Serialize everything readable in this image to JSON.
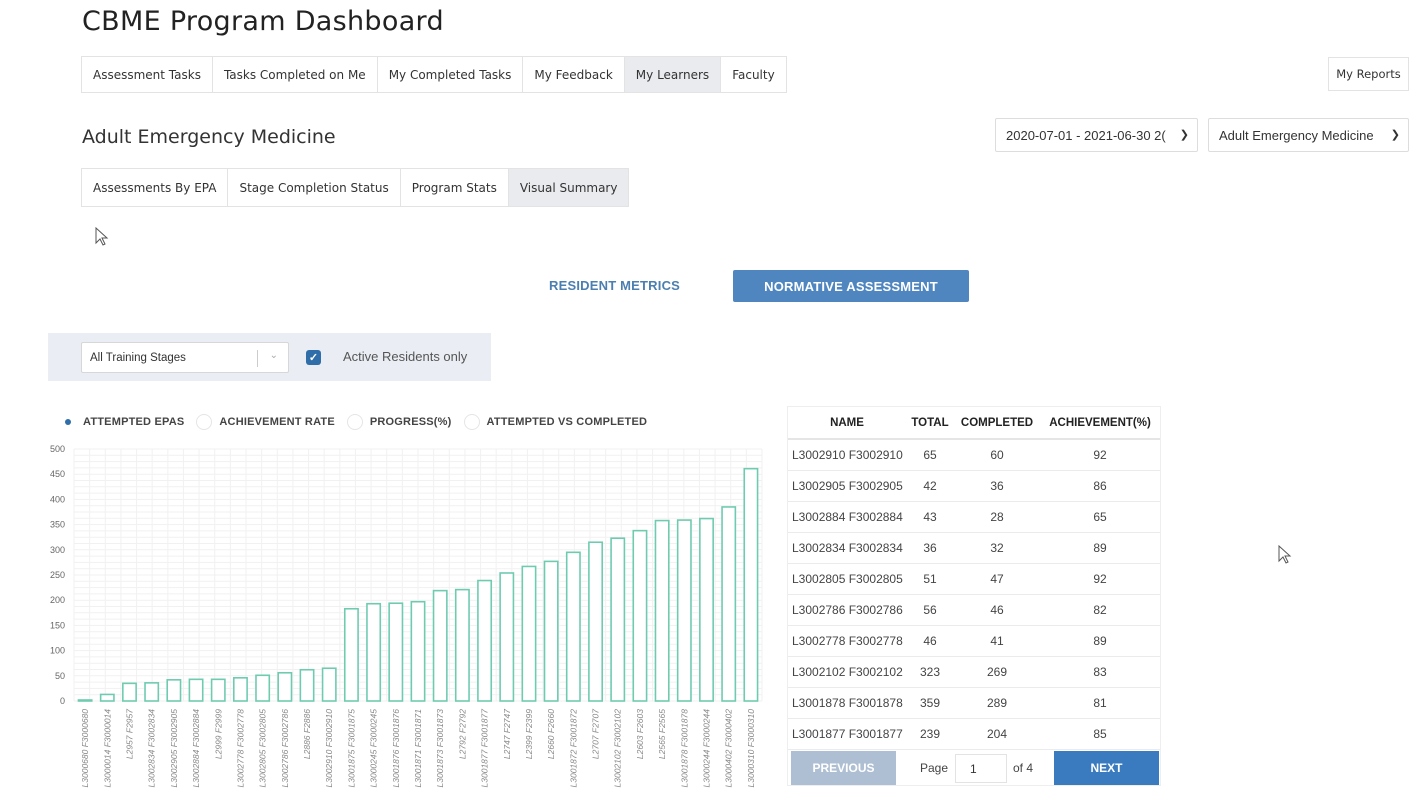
{
  "header": {
    "title": "CBME Program Dashboard"
  },
  "main_tabs": [
    {
      "label": "Assessment Tasks",
      "active": false
    },
    {
      "label": "Tasks Completed on Me",
      "active": false
    },
    {
      "label": "My Completed Tasks",
      "active": false
    },
    {
      "label": "My Feedback",
      "active": false
    },
    {
      "label": "My Learners",
      "active": true
    },
    {
      "label": "Faculty",
      "active": false
    }
  ],
  "my_reports_label": "My Reports",
  "section_title": "Adult Emergency Medicine",
  "date_select": {
    "value": "2020-07-01 - 2021-06-30 2("
  },
  "program_select": {
    "value": "Adult Emergency Medicine"
  },
  "sub_tabs": [
    {
      "label": "Assessments By EPA",
      "active": false
    },
    {
      "label": "Stage Completion Status",
      "active": false
    },
    {
      "label": "Program Stats",
      "active": false
    },
    {
      "label": "Visual Summary",
      "active": true
    }
  ],
  "metrics": {
    "resident_label": "RESIDENT METRICS",
    "normative_label": "NORMATIVE ASSESSMENT"
  },
  "filters": {
    "stage_value": "All Training Stages",
    "active_only_label": "Active Residents only",
    "active_only_checked": true
  },
  "radio_options": [
    {
      "label": "ATTEMPTED EPAS",
      "selected": true
    },
    {
      "label": "ACHIEVEMENT RATE",
      "selected": false
    },
    {
      "label": "PROGRESS(%)",
      "selected": false
    },
    {
      "label": "ATTEMPTED VS COMPLETED",
      "selected": false
    }
  ],
  "colors": {
    "bar": "#6fcbb0",
    "primary": "#4f86c0",
    "accent_dark": "#2f6ea8"
  },
  "chart_data": {
    "type": "bar",
    "ylim": [
      0,
      500
    ],
    "yticks": [
      0,
      50,
      100,
      150,
      200,
      250,
      300,
      350,
      400,
      450,
      500
    ],
    "categories": [
      "L3000680 F3000680",
      "L3000014 F3000014",
      "L2957 F2957",
      "L3002834 F3002834",
      "L3002905 F3002905",
      "L3002884 F3002884",
      "L2999 F2999",
      "L3002778 F3002778",
      "L3002805 F3002805",
      "L3002786 F3002786",
      "L2886 F2886",
      "L3002910 F3002910",
      "L3001875 F3001875",
      "L3000245 F3000245",
      "L3001876 F3001876",
      "L3001871 F3001871",
      "L3001873 F3001873",
      "L2792 F2792",
      "L3001877 F3001877",
      "L2747 F2747",
      "L2399 F2399",
      "L2660 F2660",
      "L3001872 F3001872",
      "L2707 F2707",
      "L3002102 F3002102",
      "L2603 F2603",
      "L2565 F2565",
      "L3001878 F3001878",
      "L3000244 F3000244",
      "L3000402 F3000402",
      "L3000310 F3000310"
    ],
    "values": [
      2,
      13,
      35,
      36,
      42,
      43,
      43,
      46,
      51,
      56,
      62,
      65,
      183,
      193,
      194,
      197,
      219,
      221,
      239,
      254,
      267,
      277,
      295,
      315,
      323,
      338,
      358,
      359,
      362,
      385,
      461
    ]
  },
  "table": {
    "headers": [
      "NAME",
      "TOTAL",
      "COMPLETED",
      "ACHIEVEMENT(%)"
    ],
    "rows": [
      [
        "L3002910 F3002910",
        "65",
        "60",
        "92"
      ],
      [
        "L3002905 F3002905",
        "42",
        "36",
        "86"
      ],
      [
        "L3002884 F3002884",
        "43",
        "28",
        "65"
      ],
      [
        "L3002834 F3002834",
        "36",
        "32",
        "89"
      ],
      [
        "L3002805 F3002805",
        "51",
        "47",
        "92"
      ],
      [
        "L3002786 F3002786",
        "56",
        "46",
        "82"
      ],
      [
        "L3002778 F3002778",
        "46",
        "41",
        "89"
      ],
      [
        "L3002102 F3002102",
        "323",
        "269",
        "83"
      ],
      [
        "L3001878 F3001878",
        "359",
        "289",
        "81"
      ],
      [
        "L3001877 F3001877",
        "239",
        "204",
        "85"
      ]
    ]
  },
  "pagination": {
    "prev_label": "PREVIOUS",
    "next_label": "NEXT",
    "page_label": "Page",
    "page_value": "1",
    "of_label": "of 4"
  }
}
